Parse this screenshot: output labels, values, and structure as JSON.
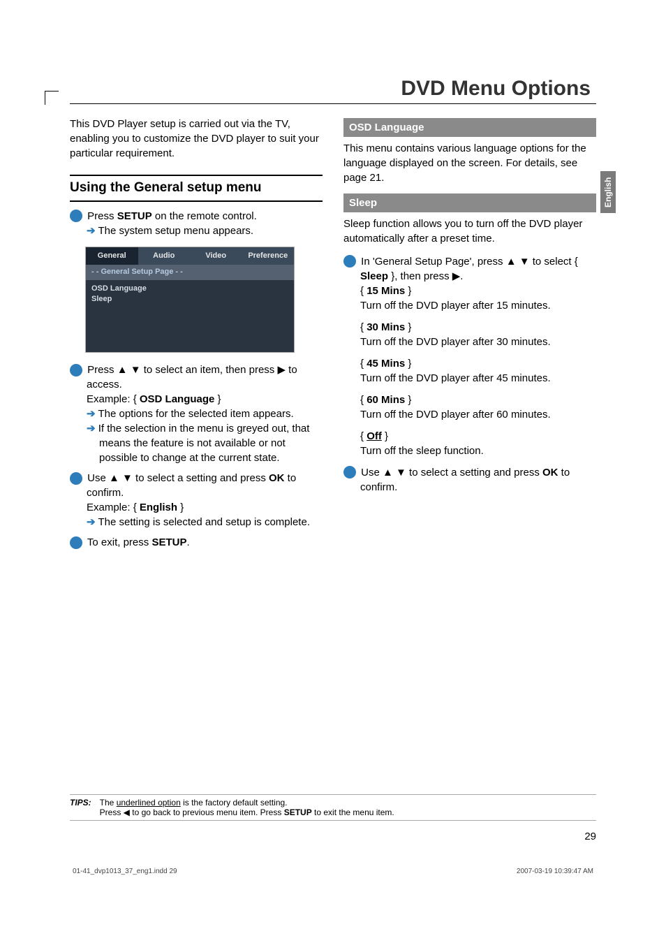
{
  "title": "DVD Menu Options",
  "side_tab": "English",
  "intro": "This DVD Player setup is carried out via the TV, enabling you to customize the DVD player to suit your particular requirement.",
  "heading_general": "Using the General setup menu",
  "step1": {
    "text_a": "Press ",
    "text_setup": "SETUP",
    "text_b": " on the remote control.",
    "result": "The system setup menu appears."
  },
  "onscreen": {
    "tabs": [
      "General",
      "Audio",
      "Video",
      "Preference"
    ],
    "banner": "- -   General Setup Page   - -",
    "items": [
      "OSD Language",
      "Sleep"
    ]
  },
  "step2": {
    "text": "Press  ▲ ▼  to select an item, then press  ▶  to access.",
    "example_label": "Example: { ",
    "example_value": "OSD Language",
    "example_close": " }",
    "result1": "The options for the selected item appears.",
    "result2": "If the selection in the menu is greyed out, that means the feature is not available or not possible to change at the current state."
  },
  "step3": {
    "text_a": "Use  ▲ ▼  to select a setting and press ",
    "ok": "OK",
    "text_b": " to confirm.",
    "example_label": "Example: { ",
    "example_value": "English",
    "example_close": " }",
    "result": "The setting is selected and setup is complete."
  },
  "step4": {
    "text_a": "To exit, press ",
    "setup": "SETUP",
    "text_b": "."
  },
  "osd_lang": {
    "heading": "OSD Language",
    "body": "This menu contains various language options for the language displayed on the screen. For details, see page 21."
  },
  "sleep": {
    "heading": "Sleep",
    "intro": "Sleep function allows you to turn off the DVD player automatically after a preset time.",
    "step1_a": "In 'General Setup Page', press  ▲ ▼  to select { ",
    "step1_sleep": "Sleep",
    "step1_b": " }, then press  ▶.",
    "options": [
      {
        "name": "15 Mins",
        "desc": "Turn off the DVD player after 15 minutes."
      },
      {
        "name": "30 Mins",
        "desc": "Turn off the DVD player after 30 minutes."
      },
      {
        "name": "45 Mins",
        "desc": "Turn off the DVD player after 45 minutes."
      },
      {
        "name": "60 Mins",
        "desc": "Turn off the DVD player after 60 minutes."
      },
      {
        "name": "Off",
        "desc": "Turn off the sleep function.",
        "underline": true
      }
    ],
    "step2_a": "Use  ▲ ▼  to select a setting and press ",
    "step2_ok": "OK",
    "step2_b": " to confirm."
  },
  "tips": {
    "label": "TIPS:",
    "line1a": "The ",
    "line1u": "underlined option",
    "line1b": " is the factory default setting.",
    "line2a": "Press  ◀  to go back to previous menu item. Press ",
    "line2_setup": "SETUP",
    "line2b": " to exit the menu item."
  },
  "page_number": "29",
  "footer_left": "01-41_dvp1013_37_eng1.indd   29",
  "footer_right": "2007-03-19   10:39:47 AM"
}
